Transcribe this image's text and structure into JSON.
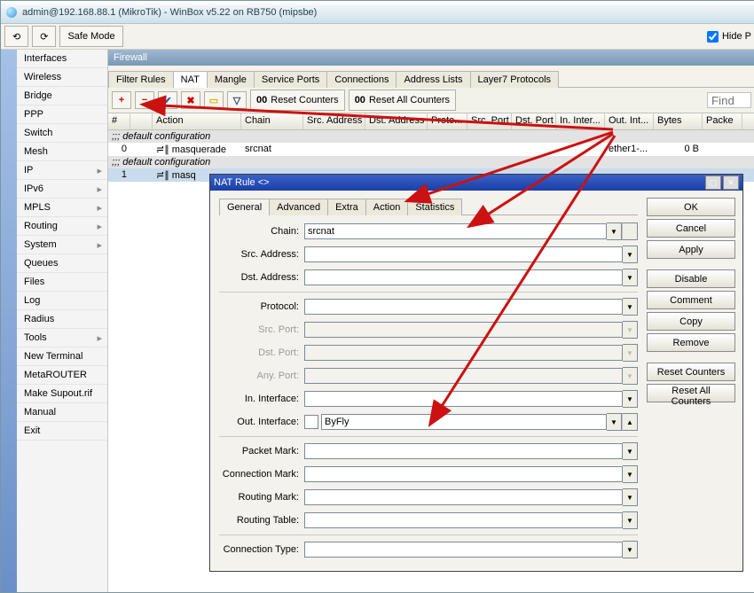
{
  "title": "admin@192.168.88.1 (MikroTik) - WinBox v5.22 on RB750 (mipsbe)",
  "toolbar": {
    "undo_icon": "undo-icon",
    "redo_icon": "redo-icon",
    "safe_mode": "Safe Mode",
    "hide": "Hide P"
  },
  "sidebar": {
    "items": [
      {
        "label": "Interfaces"
      },
      {
        "label": "Wireless"
      },
      {
        "label": "Bridge"
      },
      {
        "label": "PPP"
      },
      {
        "label": "Switch"
      },
      {
        "label": "Mesh"
      },
      {
        "label": "IP",
        "sub": true
      },
      {
        "label": "IPv6",
        "sub": true
      },
      {
        "label": "MPLS",
        "sub": true
      },
      {
        "label": "Routing",
        "sub": true
      },
      {
        "label": "System",
        "sub": true
      },
      {
        "label": "Queues"
      },
      {
        "label": "Files"
      },
      {
        "label": "Log"
      },
      {
        "label": "Radius"
      },
      {
        "label": "Tools",
        "sub": true
      },
      {
        "label": "New Terminal"
      },
      {
        "label": "MetaROUTER"
      },
      {
        "label": "Make Supout.rif"
      },
      {
        "label": "Manual"
      },
      {
        "label": "Exit"
      }
    ]
  },
  "firewall": {
    "title": "Firewall",
    "tabs": [
      "Filter Rules",
      "NAT",
      "Mangle",
      "Service Ports",
      "Connections",
      "Address Lists",
      "Layer7 Protocols"
    ],
    "active_tab": "NAT",
    "reset": "Reset Counters",
    "reset_all": "Reset All Counters",
    "counter_prefix": "00",
    "find": "Find",
    "columns": [
      "#",
      "",
      "Action",
      "Chain",
      "Src. Address",
      "Dst. Address",
      "Proto...",
      "Src. Port",
      "Dst. Port",
      "In. Inter...",
      "Out. Int...",
      "Bytes",
      "Packe"
    ],
    "group_row": ";;; default configuration",
    "rows": [
      {
        "n": "0",
        "flag": "",
        "action": "≓∥ masquerade",
        "chain": "srcnat",
        "out": "ether1-...",
        "bytes": "0 B"
      },
      {
        "n": "1",
        "flag": "",
        "action": "≓∥ masq",
        "chain": "",
        "out": "",
        "bytes": ""
      }
    ]
  },
  "dialog": {
    "title": "NAT Rule <>",
    "tabs": [
      "General",
      "Advanced",
      "Extra",
      "Action",
      "Statistics"
    ],
    "active_tab": "General",
    "fields": {
      "chain": {
        "label": "Chain:",
        "value": "srcnat",
        "mode": "select"
      },
      "src_addr": {
        "label": "Src. Address:",
        "value": "",
        "mode": "opt"
      },
      "dst_addr": {
        "label": "Dst. Address:",
        "value": "",
        "mode": "opt"
      },
      "protocol": {
        "label": "Protocol:",
        "value": "",
        "mode": "opt"
      },
      "src_port": {
        "label": "Src. Port:",
        "value": "",
        "mode": "disabled"
      },
      "dst_port": {
        "label": "Dst. Port:",
        "value": "",
        "mode": "disabled"
      },
      "any_port": {
        "label": "Any. Port:",
        "value": "",
        "mode": "disabled"
      },
      "in_if": {
        "label": "In. Interface:",
        "value": "",
        "mode": "opt"
      },
      "out_if": {
        "label": "Out. Interface:",
        "value": "ByFly",
        "mode": "check-select"
      },
      "pkt_mark": {
        "label": "Packet Mark:",
        "value": "",
        "mode": "opt"
      },
      "conn_mark": {
        "label": "Connection Mark:",
        "value": "",
        "mode": "opt"
      },
      "rt_mark": {
        "label": "Routing Mark:",
        "value": "",
        "mode": "opt"
      },
      "rt_table": {
        "label": "Routing Table:",
        "value": "",
        "mode": "opt"
      },
      "conn_type": {
        "label": "Connection Type:",
        "value": "",
        "mode": "opt"
      }
    },
    "buttons": [
      "OK",
      "Cancel",
      "Apply",
      "Disable",
      "Comment",
      "Copy",
      "Remove",
      "Reset Counters",
      "Reset All Counters"
    ]
  }
}
